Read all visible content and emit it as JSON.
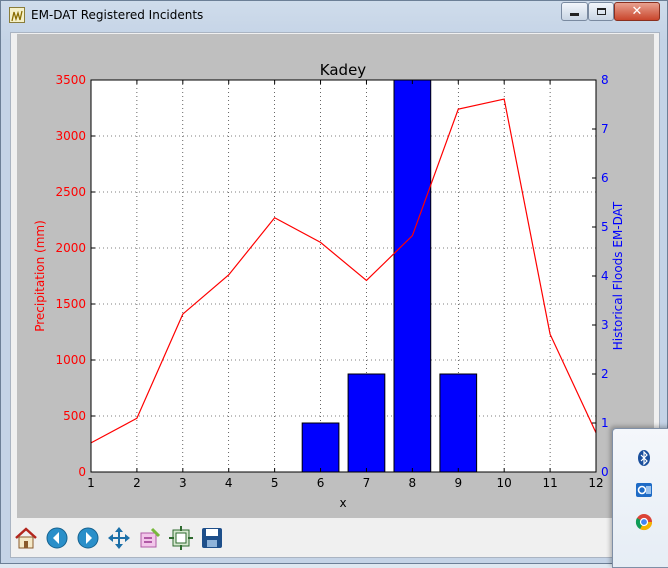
{
  "window": {
    "title": "EM-DAT Registered Incidents",
    "controls": {
      "minimize": "minimize",
      "maximize": "maximize",
      "close": "✕"
    }
  },
  "chart_data": {
    "type": "bar+line",
    "title": "Kadey",
    "xlabel": "x",
    "ylabel_left": "Precipitation (mm)",
    "ylabel_right": "Historical Floods EM-DAT",
    "x": [
      1,
      2,
      3,
      4,
      5,
      6,
      7,
      8,
      9,
      10,
      11,
      12
    ],
    "xlim": [
      1,
      12
    ],
    "ylim_left": [
      0,
      3500
    ],
    "ylim_right": [
      0,
      8
    ],
    "yticks_left": [
      0,
      500,
      1000,
      1500,
      2000,
      2500,
      3000,
      3500
    ],
    "yticks_right": [
      0,
      1,
      2,
      3,
      4,
      5,
      6,
      7,
      8
    ],
    "grid": true,
    "series": [
      {
        "kind": "line",
        "axis": "left",
        "color": "#ff0000",
        "values": [
          260,
          480,
          1410,
          1760,
          2270,
          2050,
          1710,
          2110,
          3240,
          3330,
          1230,
          350
        ]
      },
      {
        "kind": "bar",
        "axis": "right",
        "color": "#0000ff",
        "bar_x": [
          6,
          7,
          8,
          9
        ],
        "bar_values": [
          1,
          2,
          8,
          2
        ]
      }
    ]
  },
  "toolbar": {
    "buttons": [
      {
        "name": "home-icon"
      },
      {
        "name": "back-icon"
      },
      {
        "name": "forward-icon"
      },
      {
        "name": "pan-icon"
      },
      {
        "name": "zoom-icon"
      },
      {
        "name": "subplots-icon"
      },
      {
        "name": "save-icon"
      }
    ]
  },
  "tray": {
    "items": [
      {
        "name": "bluetooth-icon",
        "color": "#1a4f9c"
      },
      {
        "name": "outlook-icon",
        "color": "#1e6bc6"
      },
      {
        "name": "chrome-icon",
        "color": "#db4437"
      }
    ]
  }
}
